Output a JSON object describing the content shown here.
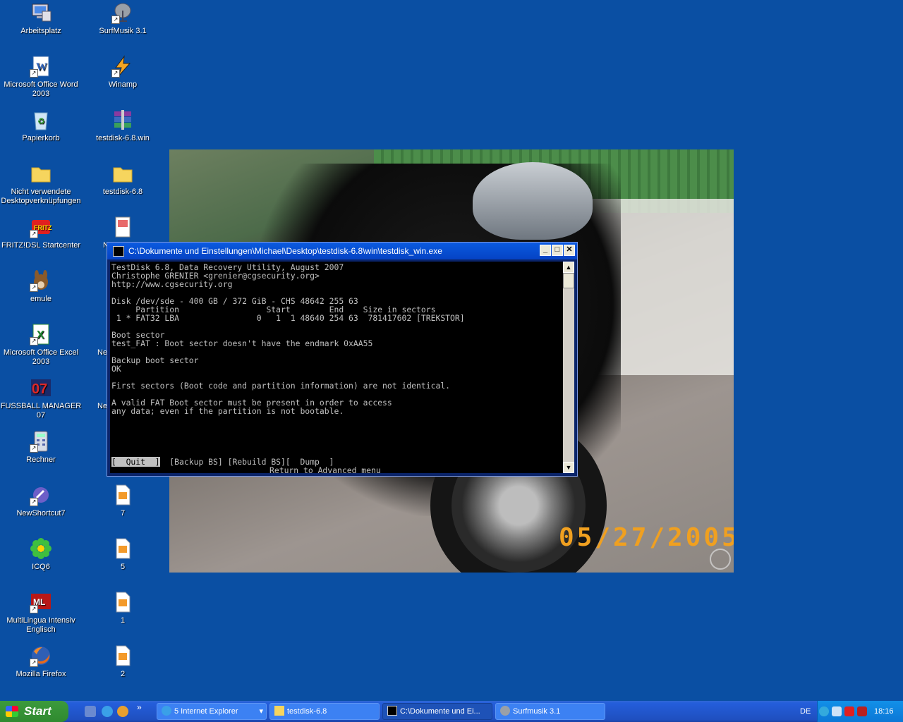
{
  "desktop": {
    "icons": [
      {
        "label": "Arbeitsplatz",
        "icon": "my-computer-icon"
      },
      {
        "label": "SurfMusik 3.1",
        "icon": "satellite-dish-icon"
      },
      {
        "label": "Microsoft Office Word 2003",
        "icon": "word-document-icon"
      },
      {
        "label": "Winamp",
        "icon": "winamp-icon"
      },
      {
        "label": "Papierkorb",
        "icon": "recycle-bin-icon"
      },
      {
        "label": "testdisk-6.8.win",
        "icon": "archive-icon"
      },
      {
        "label": "Nicht verwendete Desktopverknüpfungen",
        "icon": "folder-icon"
      },
      {
        "label": "testdisk-6.8",
        "icon": "folder-icon"
      },
      {
        "label": "FRITZ!DSL Startcenter",
        "icon": "fritz-icon"
      },
      {
        "label": "N",
        "icon": "document-icon"
      },
      {
        "label": "emule",
        "icon": "emule-icon"
      },
      {
        "label": "Microsoft Office Excel 2003",
        "icon": "excel-icon"
      },
      {
        "label": "Ne",
        "icon": "document-icon"
      },
      {
        "label": "FUSSBALL MANAGER 07",
        "icon": "fussball-manager-icon"
      },
      {
        "label": "Ne",
        "icon": "document-icon"
      },
      {
        "label": "Rechner",
        "icon": "calculator-icon"
      },
      {
        "label": "NewShortcut7",
        "icon": "shortcut-icon"
      },
      {
        "label": "7",
        "icon": "image-file-icon"
      },
      {
        "label": "ICQ6",
        "icon": "icq-icon"
      },
      {
        "label": "5",
        "icon": "image-file-icon"
      },
      {
        "label": "MultiLingua Intensiv Englisch",
        "icon": "multilingua-icon"
      },
      {
        "label": "1",
        "icon": "image-file-icon"
      },
      {
        "label": "Mozilla Firefox",
        "icon": "firefox-icon"
      },
      {
        "label": "2",
        "icon": "image-file-icon"
      }
    ]
  },
  "wallpaper": {
    "date_stamp": "05/27/2005"
  },
  "console_window": {
    "title": "C:\\Dokumente und Einstellungen\\Michael\\Desktop\\testdisk-6.8\\win\\testdisk_win.exe",
    "lines": [
      "TestDisk 6.8, Data Recovery Utility, August 2007",
      "Christophe GRENIER <grenier@cgsecurity.org>",
      "http://www.cgsecurity.org",
      "",
      "Disk /dev/sde - 400 GB / 372 GiB - CHS 48642 255 63",
      "     Partition                  Start        End    Size in sectors",
      " 1 * FAT32 LBA                0   1  1 48640 254 63  781417602 [TREKSTOR]",
      "",
      "Boot sector",
      "test_FAT : Boot sector doesn't have the endmark 0xAA55",
      "",
      "Backup boot sector",
      "OK",
      "",
      "First sectors (Boot code and partition information) are not identical.",
      "",
      "A valid FAT Boot sector must be present in order to access",
      "any data; even if the partition is not bootable.",
      "",
      "",
      "",
      ""
    ],
    "menu": {
      "quit": "[  Quit  ]",
      "backup": "[Backup BS]",
      "rebuild": "[Rebuild BS]",
      "dump": "[  Dump  ]"
    },
    "status": "Return to Advanced menu",
    "buttons": {
      "minimize": "_",
      "maximize": "□",
      "close": "✕"
    }
  },
  "taskbar": {
    "start_label": "Start",
    "more": "»",
    "tasks": [
      {
        "label": "5 Internet Explorer",
        "arrow": "▾"
      },
      {
        "label": "testdisk-6.8"
      },
      {
        "label": "C:\\Dokumente und Ei..."
      },
      {
        "label": "Surfmusik 3.1"
      }
    ],
    "language": "DE",
    "clock": "18:16"
  }
}
